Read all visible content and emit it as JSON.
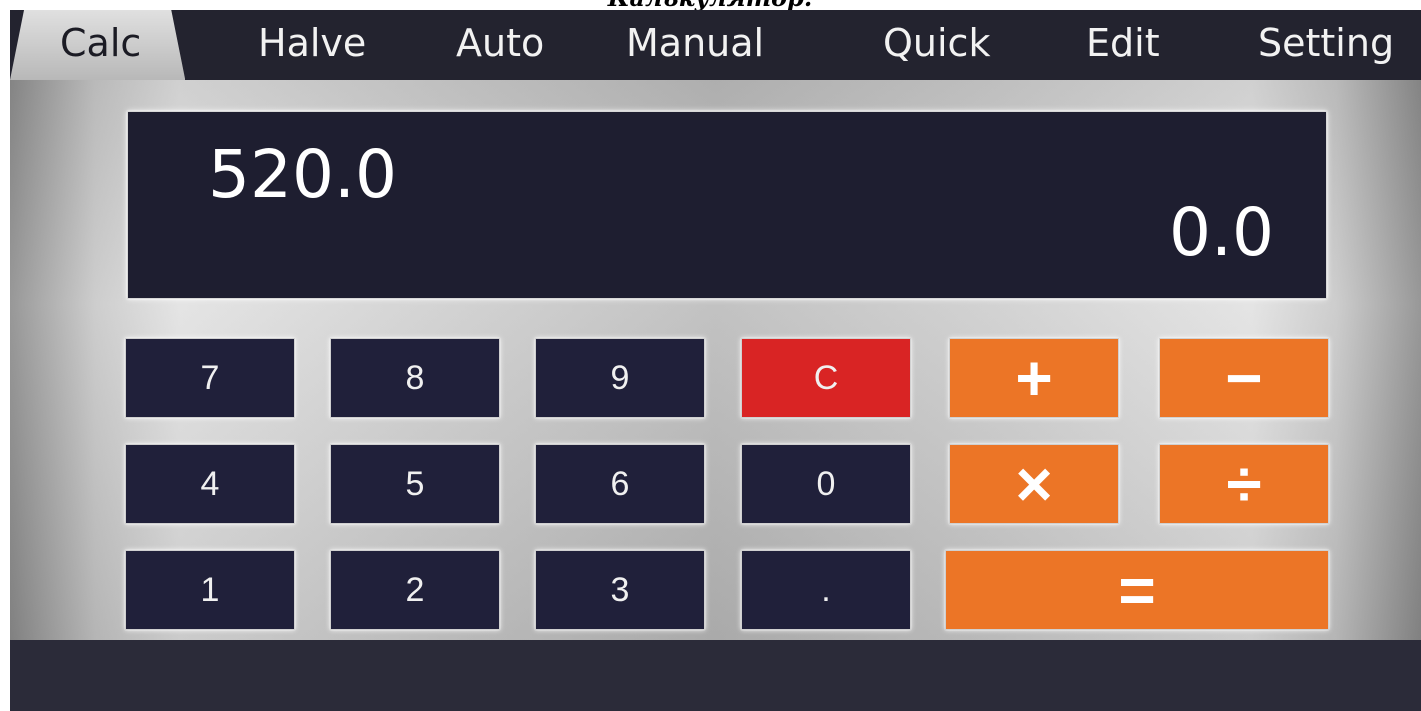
{
  "caption": "Калькулятор.",
  "tabs": [
    {
      "label": "Calc",
      "active": true
    },
    {
      "label": "Halve",
      "active": false
    },
    {
      "label": "Auto",
      "active": false
    },
    {
      "label": "Manual",
      "active": false
    },
    {
      "label": "Quick",
      "active": false
    },
    {
      "label": "Edit",
      "active": false
    },
    {
      "label": "Setting",
      "active": false
    }
  ],
  "display": {
    "main_value": "520.0",
    "secondary_value": "0.0"
  },
  "keys": {
    "k7": "7",
    "k8": "8",
    "k9": "9",
    "clear": "C",
    "k4": "4",
    "k5": "5",
    "k6": "6",
    "k0": "0",
    "k1": "1",
    "k2": "2",
    "k3": "3",
    "dot": ".",
    "plus": "+",
    "minus": "−",
    "multiply": "×",
    "divide": "÷",
    "equals": "="
  },
  "colors": {
    "accent_orange": "#ec7526",
    "clear_red": "#d92424",
    "key_dark": "#20203a",
    "display_bg": "#1e1e30"
  }
}
